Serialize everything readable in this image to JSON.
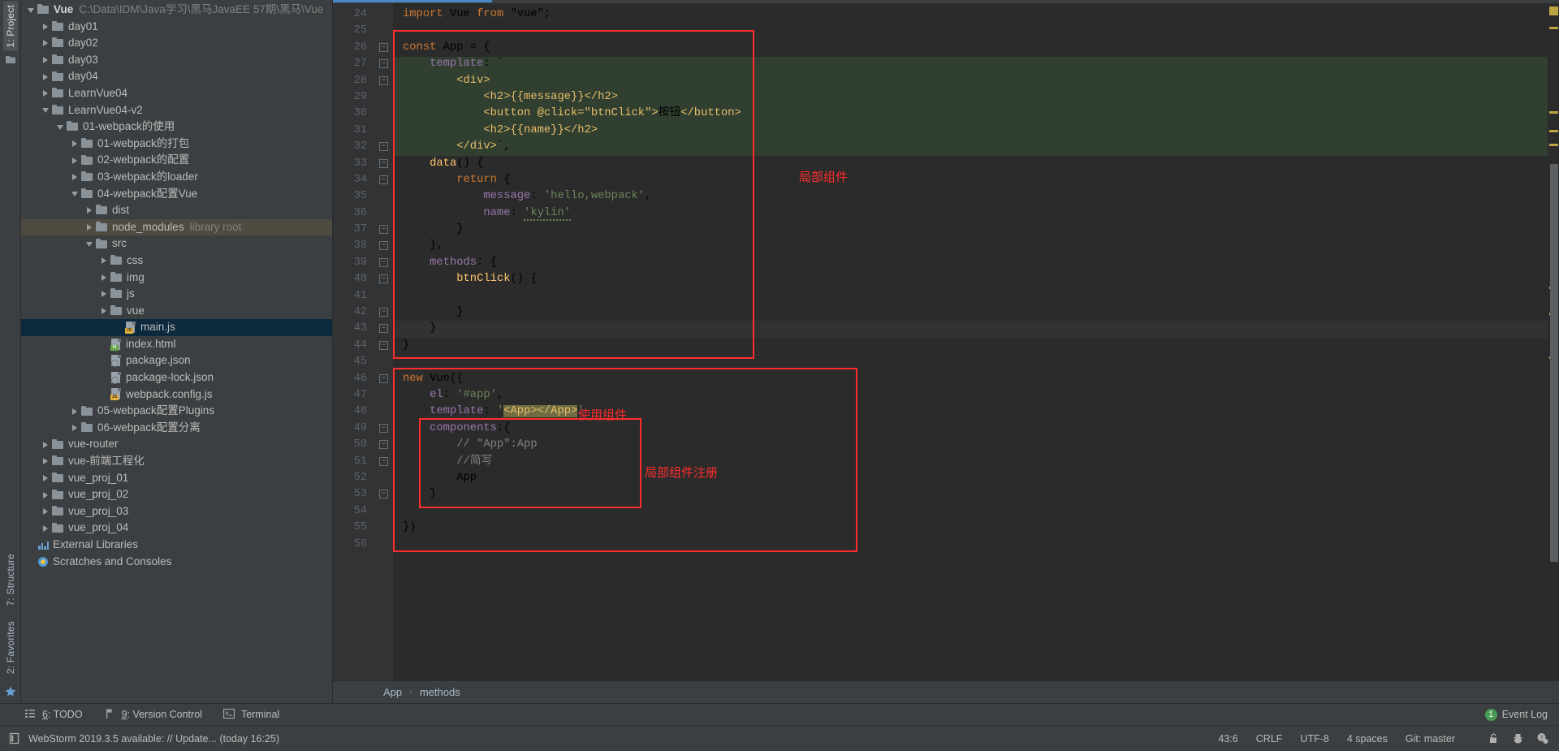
{
  "window": {
    "left_tabs": [
      {
        "label": "1: Project",
        "active": true
      },
      {
        "label": "7: Structure",
        "active": false
      },
      {
        "label": "2: Favorites",
        "active": false
      }
    ]
  },
  "project_tree": {
    "rows": [
      {
        "indent": 0,
        "arrow": "expanded",
        "icon": "folder",
        "label": "Vue",
        "bold": true,
        "dim": "C:\\Data\\IDM\\Java学习\\黑马JavaEE 57期\\黑马\\Vue",
        "state": "none"
      },
      {
        "indent": 1,
        "arrow": "collapsed",
        "icon": "folder",
        "label": "day01",
        "dim": "",
        "state": "none"
      },
      {
        "indent": 1,
        "arrow": "collapsed",
        "icon": "folder",
        "label": "day02",
        "dim": "",
        "state": "none"
      },
      {
        "indent": 1,
        "arrow": "collapsed",
        "icon": "folder",
        "label": "day03",
        "dim": "",
        "state": "none"
      },
      {
        "indent": 1,
        "arrow": "collapsed",
        "icon": "folder",
        "label": "day04",
        "dim": "",
        "state": "none"
      },
      {
        "indent": 1,
        "arrow": "collapsed",
        "icon": "folder",
        "label": "LearnVue04",
        "dim": "",
        "state": "none"
      },
      {
        "indent": 1,
        "arrow": "expanded",
        "icon": "folder",
        "label": "LearnVue04-v2",
        "dim": "",
        "state": "none"
      },
      {
        "indent": 2,
        "arrow": "expanded",
        "icon": "folder",
        "label": "01-webpack的使用",
        "dim": "",
        "state": "none"
      },
      {
        "indent": 3,
        "arrow": "collapsed",
        "icon": "folder",
        "label": "01-webpack的打包",
        "dim": "",
        "state": "none"
      },
      {
        "indent": 3,
        "arrow": "collapsed",
        "icon": "folder",
        "label": "02-webpack的配置",
        "dim": "",
        "state": "none"
      },
      {
        "indent": 3,
        "arrow": "collapsed",
        "icon": "folder",
        "label": "03-webpack的loader",
        "dim": "",
        "state": "none"
      },
      {
        "indent": 3,
        "arrow": "expanded",
        "icon": "folder",
        "label": "04-webpack配置Vue",
        "dim": "",
        "state": "none"
      },
      {
        "indent": 4,
        "arrow": "collapsed",
        "icon": "folder",
        "label": "dist",
        "dim": "",
        "state": "none"
      },
      {
        "indent": 4,
        "arrow": "collapsed",
        "icon": "folder",
        "label": "node_modules",
        "dim": "library root",
        "state": "olive"
      },
      {
        "indent": 4,
        "arrow": "expanded",
        "icon": "folder",
        "label": "src",
        "dim": "",
        "state": "none"
      },
      {
        "indent": 5,
        "arrow": "collapsed",
        "icon": "folder",
        "label": "css",
        "dim": "",
        "state": "none"
      },
      {
        "indent": 5,
        "arrow": "collapsed",
        "icon": "folder",
        "label": "img",
        "dim": "",
        "state": "none"
      },
      {
        "indent": 5,
        "arrow": "collapsed",
        "icon": "folder",
        "label": "js",
        "dim": "",
        "state": "none"
      },
      {
        "indent": 5,
        "arrow": "collapsed",
        "icon": "folder",
        "label": "vue",
        "dim": "",
        "state": "none"
      },
      {
        "indent": 6,
        "arrow": "none",
        "icon": "file-js",
        "label": "main.js",
        "dim": "",
        "state": "blue"
      },
      {
        "indent": 5,
        "arrow": "none",
        "icon": "file-html",
        "label": "index.html",
        "dim": "",
        "state": "none"
      },
      {
        "indent": 5,
        "arrow": "none",
        "icon": "file-json",
        "label": "package.json",
        "dim": "",
        "state": "none"
      },
      {
        "indent": 5,
        "arrow": "none",
        "icon": "file-json",
        "label": "package-lock.json",
        "dim": "",
        "state": "none"
      },
      {
        "indent": 5,
        "arrow": "none",
        "icon": "file-js",
        "label": "webpack.config.js",
        "dim": "",
        "state": "none"
      },
      {
        "indent": 3,
        "arrow": "collapsed",
        "icon": "folder",
        "label": "05-webpack配置Plugins",
        "dim": "",
        "state": "none"
      },
      {
        "indent": 3,
        "arrow": "collapsed",
        "icon": "folder",
        "label": "06-webpack配置分离",
        "dim": "",
        "state": "none"
      },
      {
        "indent": 1,
        "arrow": "collapsed",
        "icon": "folder",
        "label": "vue-router",
        "dim": "",
        "state": "none"
      },
      {
        "indent": 1,
        "arrow": "collapsed",
        "icon": "folder",
        "label": "vue-前端工程化",
        "dim": "",
        "state": "none"
      },
      {
        "indent": 1,
        "arrow": "collapsed",
        "icon": "folder",
        "label": "vue_proj_01",
        "dim": "",
        "state": "none"
      },
      {
        "indent": 1,
        "arrow": "collapsed",
        "icon": "folder",
        "label": "vue_proj_02",
        "dim": "",
        "state": "none"
      },
      {
        "indent": 1,
        "arrow": "collapsed",
        "icon": "folder",
        "label": "vue_proj_03",
        "dim": "",
        "state": "none"
      },
      {
        "indent": 1,
        "arrow": "collapsed",
        "icon": "folder",
        "label": "vue_proj_04",
        "dim": "",
        "state": "none"
      },
      {
        "indent": 0,
        "arrow": "none",
        "icon": "library",
        "label": "External Libraries",
        "dim": "",
        "state": "none"
      },
      {
        "indent": 0,
        "arrow": "none",
        "icon": "scratch",
        "label": "Scratches and Consoles",
        "dim": "",
        "state": "none"
      }
    ]
  },
  "editor": {
    "first_line_number": 24,
    "lines": [
      {
        "n": 24,
        "fold": "",
        "text": "import Vue from \"vue\";"
      },
      {
        "n": 25,
        "fold": "",
        "text": ""
      },
      {
        "n": 26,
        "fold": "minus",
        "text": "const App = {"
      },
      {
        "n": 27,
        "fold": "minus",
        "text": "    template: `"
      },
      {
        "n": 28,
        "fold": "minus",
        "text": "        <div>"
      },
      {
        "n": 29,
        "fold": "",
        "text": "            <h2>{{message}}</h2>"
      },
      {
        "n": 30,
        "fold": "",
        "text": "            <button @click=\"btnClick\">按钮</button>"
      },
      {
        "n": 31,
        "fold": "",
        "text": "            <h2>{{name}}</h2>"
      },
      {
        "n": 32,
        "fold": "minus",
        "text": "        </div>`,"
      },
      {
        "n": 33,
        "fold": "minus",
        "text": "    data() {"
      },
      {
        "n": 34,
        "fold": "minus",
        "text": "        return {"
      },
      {
        "n": 35,
        "fold": "",
        "text": "            message: 'hello,webpack',"
      },
      {
        "n": 36,
        "fold": "",
        "text": "            name: 'kylin'"
      },
      {
        "n": 37,
        "fold": "minus",
        "text": "        }"
      },
      {
        "n": 38,
        "fold": "minus",
        "text": "    },"
      },
      {
        "n": 39,
        "fold": "minus",
        "text": "    methods: {"
      },
      {
        "n": 40,
        "fold": "minus",
        "text": "        btnClick() {"
      },
      {
        "n": 41,
        "fold": "",
        "text": ""
      },
      {
        "n": 42,
        "fold": "minus",
        "text": "        }"
      },
      {
        "n": 43,
        "fold": "minus",
        "text": "    }"
      },
      {
        "n": 44,
        "fold": "minus",
        "text": "}"
      },
      {
        "n": 45,
        "fold": "",
        "text": ""
      },
      {
        "n": 46,
        "fold": "minus",
        "text": "new Vue({"
      },
      {
        "n": 47,
        "fold": "",
        "text": "    el: '#app',"
      },
      {
        "n": 48,
        "fold": "",
        "text": "    template: '<App></App>',"
      },
      {
        "n": 49,
        "fold": "minus",
        "text": "    components:{"
      },
      {
        "n": 50,
        "fold": "minus",
        "text": "        // \"App\":App"
      },
      {
        "n": 51,
        "fold": "minus",
        "text": "        //简写"
      },
      {
        "n": 52,
        "fold": "",
        "text": "        App"
      },
      {
        "n": 53,
        "fold": "minus",
        "text": "    }"
      },
      {
        "n": 54,
        "fold": "",
        "text": ""
      },
      {
        "n": 55,
        "fold": "",
        "text": "})"
      },
      {
        "n": 56,
        "fold": "",
        "text": ""
      }
    ],
    "current_line": 43
  },
  "annotations": [
    {
      "name": "local-component",
      "text": "局部组件"
    },
    {
      "name": "use-component",
      "text": "使用组件"
    },
    {
      "name": "local-component-register",
      "text": "局部组件注册"
    }
  ],
  "breadcrumb": {
    "items": [
      "App",
      "methods"
    ],
    "separator": "›"
  },
  "bottom_tools": {
    "items": [
      {
        "label_prefix": "6",
        "label": ": TODO",
        "icon": "todo-icon"
      },
      {
        "label_prefix": "9",
        "label": ": Version Control",
        "icon": "version-control-icon"
      },
      {
        "label_prefix": "",
        "label": "Terminal",
        "icon": "terminal-icon"
      }
    ],
    "event_log": {
      "label": "Event Log",
      "count": "1"
    }
  },
  "statusbar": {
    "message": "WebStorm 2019.3.5 available: // Update... (today 16:25)",
    "caret": "43:6",
    "line_sep": "CRLF",
    "encoding": "UTF-8",
    "indent": "4 spaces",
    "branch": "Git: master"
  },
  "colors": {
    "accent_blue": "#4a88c7",
    "annotation_red": "#ff2d2d",
    "selection_blue": "#0d293e",
    "selection_olive": "#4f4b41",
    "editor_bg": "#2b2b2b",
    "panel_bg": "#3c3f41",
    "template_band": "#313f30"
  }
}
